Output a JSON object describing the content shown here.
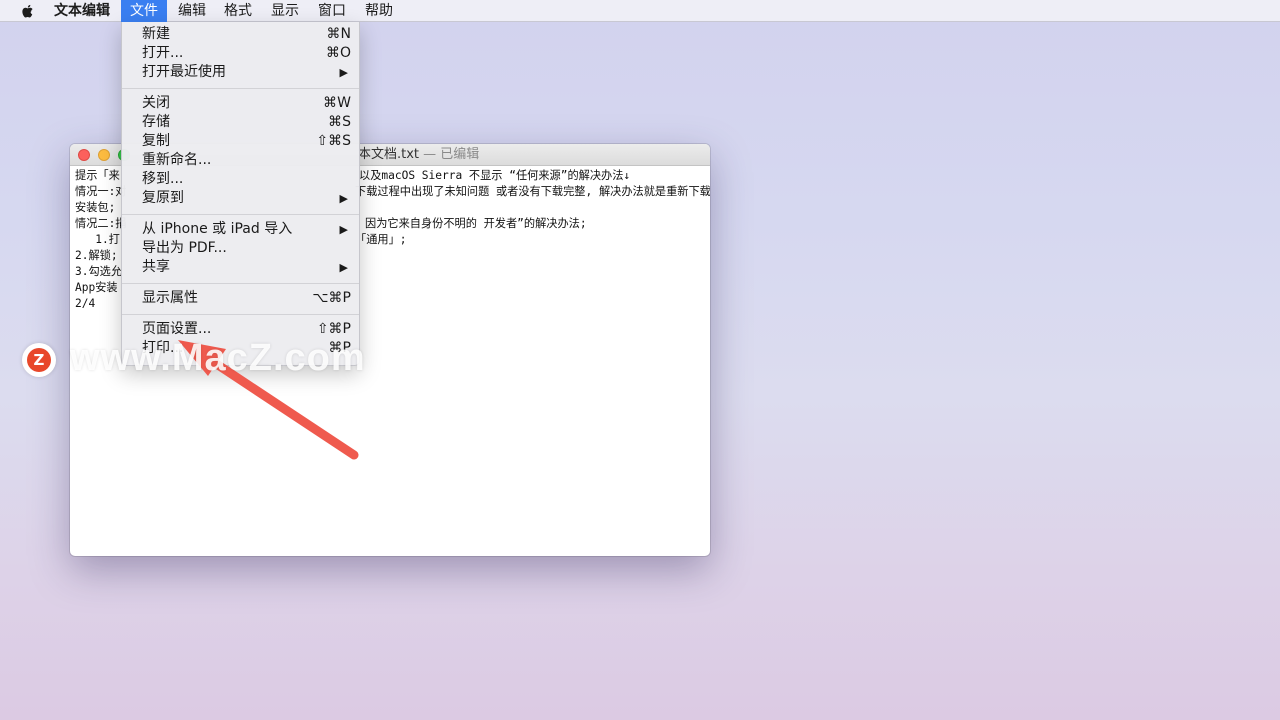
{
  "menubar": {
    "items": [
      "文本编辑",
      "文件",
      "编辑",
      "格式",
      "显示",
      "窗口",
      "帮助"
    ],
    "active_index": 1
  },
  "window": {
    "title": "本文档.txt",
    "edited": "— 已编辑",
    "lines_left": [
      "提示「来",
      "情况一:对",
      "安装包;",
      "情况二:捐",
      "   1.打",
      "2.解锁;",
      "3.勾选允",
      "App安装",
      "2/4"
    ],
    "lines_right": [
      "以及macOS Sierra 不显示 “任何来源”的解决办法↓",
      "下载过程中出现了未知问题 或者没有下载完整, 解决办法就是重新下载",
      "",
      "因为它来自身份不明的 开发者”的解决办法;",
      "「通用」;",
      "",
      "",
      "",
      ""
    ]
  },
  "file_menu": {
    "groups": [
      [
        {
          "label": "新建",
          "shortcut": "⌘N"
        },
        {
          "label": "打开...",
          "shortcut": "⌘O"
        },
        {
          "label": "打开最近使用",
          "submenu": true
        }
      ],
      [
        {
          "label": "关闭",
          "shortcut": "⌘W"
        },
        {
          "label": "存储",
          "shortcut": "⌘S"
        },
        {
          "label": "复制",
          "shortcut": "⇧⌘S"
        },
        {
          "label": "重新命名..."
        },
        {
          "label": "移到..."
        },
        {
          "label": "复原到",
          "submenu": true
        }
      ],
      [
        {
          "label": "从 iPhone 或 iPad 导入",
          "submenu": true
        },
        {
          "label": "导出为 PDF..."
        },
        {
          "label": "共享",
          "submenu": true
        }
      ],
      [
        {
          "label": "显示属性",
          "shortcut": "⌥⌘P"
        }
      ],
      [
        {
          "label": "页面设置...",
          "shortcut": "⇧⌘P"
        },
        {
          "label": "打印...",
          "shortcut": "⌘P"
        }
      ]
    ]
  },
  "watermark": {
    "logo_letter": "Z",
    "text": "www.MacZ.com"
  },
  "colors": {
    "menu_highlight": "#3a7ff1",
    "arrow": "#ef5a4e",
    "close": "#fc605c",
    "minimize": "#fdbc40",
    "zoom": "#34c84a"
  }
}
